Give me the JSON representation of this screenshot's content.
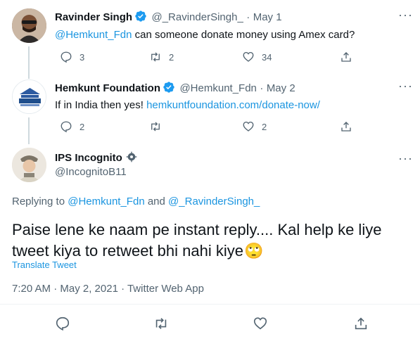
{
  "tweet1": {
    "name": "Ravinder Singh",
    "handle": "@_RavinderSingh_",
    "sep": "·",
    "date": "May 1",
    "mention": "@Hemkunt_Fdn",
    "text": " can someone donate money using Amex card?",
    "replies": "3",
    "retweets": "2",
    "likes": "34"
  },
  "tweet2": {
    "name": "Hemkunt Foundation",
    "handle": "@Hemkunt_Fdn",
    "sep": "·",
    "date": "May 2",
    "text": "If in India then yes! ",
    "link": "hemkuntfoundation.com/donate-now/",
    "replies": "2",
    "retweets": "",
    "likes": "2"
  },
  "main": {
    "name": "IPS Incognito",
    "handle": "@IncognitoB11",
    "replying_prefix": "Replying to ",
    "reply_to_1": "@Hemkunt_Fdn",
    "reply_and": " and ",
    "reply_to_2": "@_RavinderSingh_",
    "text_line1": "Paise lene ke naam pe instant reply.... Kal help ke liye",
    "text_line2": "tweet kiya to retweet bhi nahi kiye",
    "emoji": "🙄",
    "translate": "Translate Tweet",
    "meta": "7:20 AM · May 2, 2021 · Twitter Web App"
  },
  "colors": {
    "accent": "#1b95e0",
    "muted": "#536471",
    "verified": "#1d9bf0"
  },
  "icons": {
    "more": "more-dots-icon",
    "reply": "reply-icon",
    "retweet": "retweet-icon",
    "like": "heart-icon",
    "share": "share-icon",
    "verified": "verified-badge-icon",
    "protected": "protected-badge-icon"
  }
}
